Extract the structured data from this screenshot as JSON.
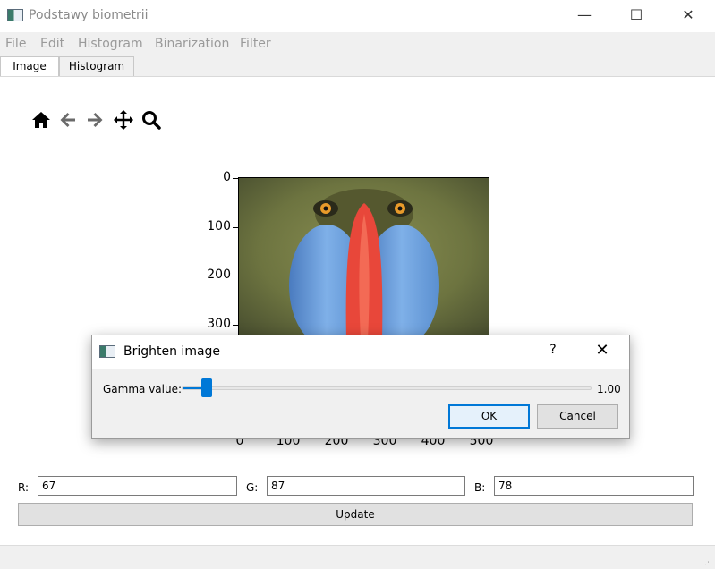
{
  "window": {
    "title": "Podstawy biometrii",
    "minimize_glyph": "—",
    "maximize_glyph": "☐",
    "close_glyph": "✕"
  },
  "menu": {
    "items": [
      "File",
      "Edit",
      "Histogram",
      "Binarization",
      "Filter"
    ]
  },
  "tabs": [
    {
      "label": "Image",
      "active": true
    },
    {
      "label": "Histogram",
      "active": false
    }
  ],
  "toolbar": {
    "icons": [
      "home-icon",
      "back-arrow-icon",
      "forward-arrow-icon",
      "pan-move-icon",
      "zoom-magnifier-icon"
    ]
  },
  "plot": {
    "y_ticks": [
      "0",
      "100",
      "200",
      "300"
    ],
    "x_ticks": [
      "0",
      "100",
      "200",
      "300",
      "400",
      "500"
    ]
  },
  "rgb": {
    "r_label": "R:",
    "r_value": "67",
    "g_label": "G:",
    "g_value": "87",
    "b_label": "B:",
    "b_value": "78"
  },
  "update_label": "Update",
  "dialog": {
    "title": "Brighten image",
    "help_glyph": "?",
    "close_glyph": "✕",
    "gamma_label": "Gamma value:",
    "gamma_value": "1.00",
    "ok_label": "OK",
    "cancel_label": "Cancel",
    "slider_fraction": 0.05
  },
  "colors": {
    "accent": "#0078d7",
    "pane_bg": "#ffffff",
    "window_bg": "#f0f0f0"
  }
}
